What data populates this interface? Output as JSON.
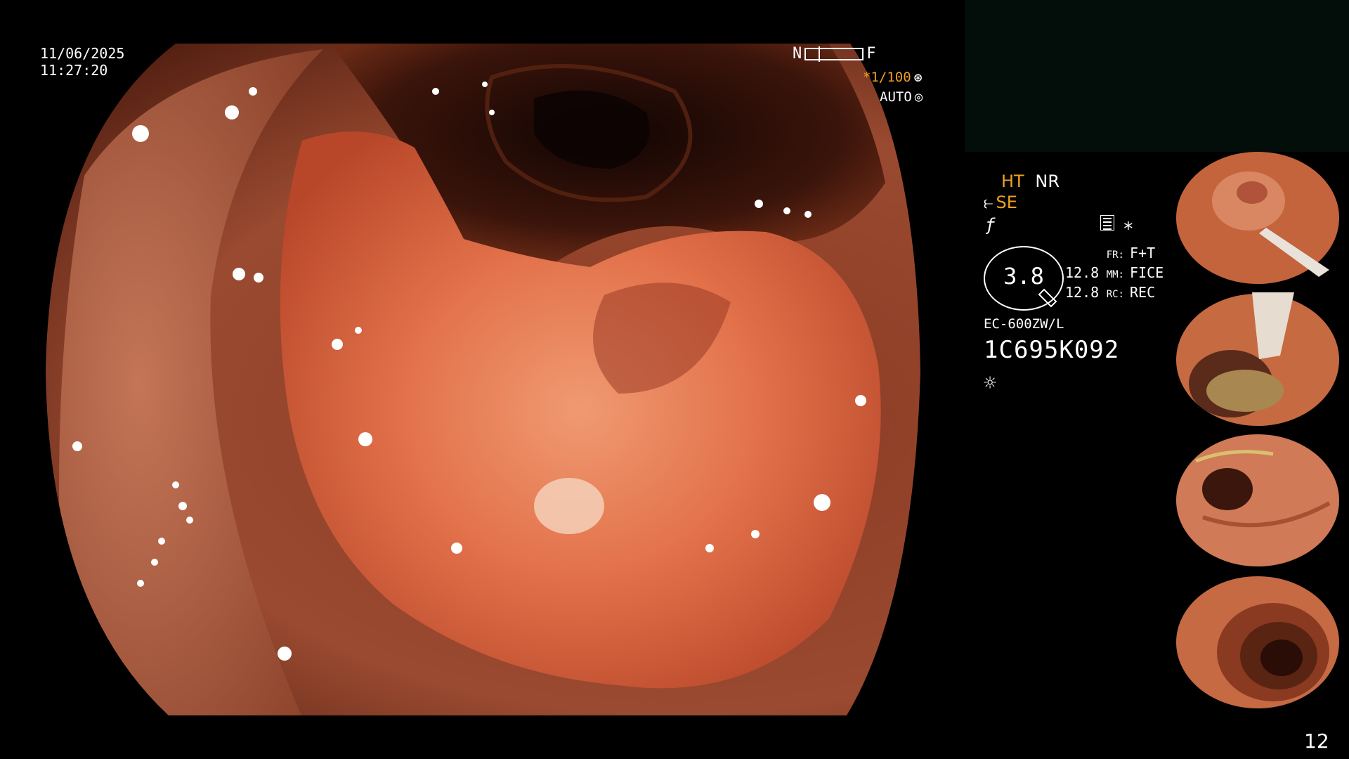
{
  "overlay": {
    "date": "11/06/2025",
    "time": "11:27:20",
    "scale_near": "N",
    "scale_far": "F",
    "shutter": "*1/100",
    "iris_mode": "AUTO"
  },
  "status": {
    "ht": "HT",
    "nr": "NR",
    "se": "SE",
    "zoom_value": "3.8",
    "readouts": [
      {
        "num": "",
        "key": "FR:",
        "value": "F+T"
      },
      {
        "num": "12.8",
        "key": "MM:",
        "value": "FICE"
      },
      {
        "num": "12.8",
        "key": "RC:",
        "value": "REC"
      }
    ],
    "scope_model": "EC-600ZW/L",
    "scope_serial": "1C695K092"
  },
  "icons": {
    "shutter": "aperture-icon",
    "auto": "iris-icon",
    "se": "enhance-icon",
    "f": "function-icon",
    "menu": "menu-icon",
    "asterisk": "asterisk-icon",
    "light": "light-icon"
  },
  "thumbnails": [
    {
      "label": "captured-image-1"
    },
    {
      "label": "captured-image-2"
    },
    {
      "label": "captured-image-3"
    },
    {
      "label": "captured-image-4"
    }
  ],
  "page_number": "12",
  "colors": {
    "accent": "#f0a020",
    "tissue": "#c9643f",
    "lesion": "#e2714a",
    "lumen": "#2a0f08"
  }
}
